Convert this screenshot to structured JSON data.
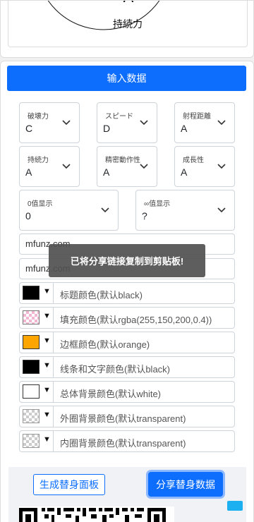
{
  "chart": {
    "center_letter": "A",
    "stat_label": "持続力"
  },
  "form": {
    "header_label": "输入数据",
    "selects": [
      {
        "label": "破壊力",
        "value": "C"
      },
      {
        "label": "スピード",
        "value": "D"
      },
      {
        "label": "射程距離",
        "value": "A"
      },
      {
        "label": "持続力",
        "value": "A"
      },
      {
        "label": "精密動作性",
        "value": "A"
      },
      {
        "label": "成長性",
        "value": "A"
      }
    ],
    "extra_selects": [
      {
        "label": "0值显示",
        "value": "0"
      },
      {
        "label": "∞值显示",
        "value": "?"
      }
    ],
    "text_inputs": [
      {
        "value": "mfunz.com"
      },
      {
        "value": "mfunz.com"
      }
    ],
    "colors": [
      {
        "label": "标题颜色(默认black)",
        "swatch": "#000000"
      },
      {
        "label": "填充颜色(默认rgba(255,150,200,0.4))",
        "swatch": "rgba(255,150,200,0.4)"
      },
      {
        "label": "边框颜色(默认orange)",
        "swatch": "#ffa500"
      },
      {
        "label": "线条和文字颜色(默认black)",
        "swatch": "#000000"
      },
      {
        "label": "总体背景颜色(默认white)",
        "swatch": "#ffffff"
      },
      {
        "label": "外圈背景颜色(默认transparent)",
        "swatch": "transparent"
      },
      {
        "label": "内圈背景颜色(默认transparent)",
        "swatch": "transparent"
      }
    ],
    "caret": "▼"
  },
  "toast": {
    "message": "已将分享链接复制到剪贴板!"
  },
  "footer": {
    "generate_label": "生成替身面板",
    "share_label": "分享替身数据"
  },
  "accent_color": "#0d6efd"
}
